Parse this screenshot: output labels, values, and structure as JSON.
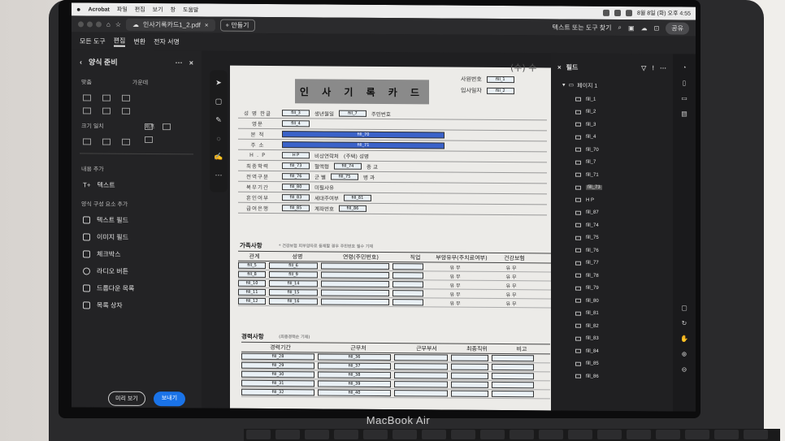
{
  "menubar": {
    "app": "Acrobat",
    "items": [
      "파일",
      "편집",
      "보기",
      "창",
      "도움말"
    ],
    "clock": "8월 8일 (화) 오후 4:55"
  },
  "tabbar": {
    "file_tab": "인사기록카드1_2.pdf",
    "new_tab": "+ 만들기",
    "search_tools": "텍스트 또는 도구 찾기",
    "share": "공유"
  },
  "toolrow": {
    "tabs": [
      "모든 도구",
      "편집",
      "변환",
      "전자 서명"
    ]
  },
  "left_panel": {
    "title": "양식 준비",
    "align_label": "맞춤",
    "horizontal_label": "가운데",
    "size_label": "크기 일치",
    "distribute_label": "배포",
    "add_content_label": "내용 추가",
    "text_item": "텍스트",
    "form_elements_label": "양식 구성 요소 추가",
    "form_items": [
      "텍스트 필드",
      "이미지 필드",
      "체크박스",
      "라디오 버튼",
      "드롭다운 목록",
      "목록 상자"
    ],
    "preview_button": "미리 보기",
    "next_button": "보내기"
  },
  "document": {
    "corner": "(수) 수",
    "title": "인 사 기 록 카 드",
    "top_fields": [
      {
        "label": "사원번호",
        "value": "fill_1"
      },
      {
        "label": "입사일자",
        "value": "fill_2"
      }
    ],
    "rows": [
      {
        "label": "성 명   한글",
        "field": "fill_3",
        "mid": "생년월일",
        "field2": "fill_7",
        "right": "주민번호"
      },
      {
        "label": "영문",
        "field": "fill_4",
        "mid": "",
        "field2": "",
        "right": ""
      },
      {
        "label": "본 적",
        "field": "fill_70",
        "mid": "",
        "field2": "",
        "right": ""
      },
      {
        "label": "주 소",
        "field": "fill_71",
        "mid": "",
        "field2": "",
        "right": ""
      },
      {
        "label": "H . P",
        "field": "H P",
        "mid": "비상연락처",
        "field2": "",
        "right": "(주택) 성명"
      },
      {
        "label": "최종학력",
        "field": "fill_73",
        "mid": "혈액형",
        "field2": "fill_74",
        "right": "종 교"
      },
      {
        "label": "전역구분",
        "field": "fill_76",
        "mid": "군 별",
        "field2": "fill_75",
        "right": "병 과"
      },
      {
        "label": "복무기간",
        "field": "fill_80",
        "mid": "미필사유",
        "field2": "",
        "right": ""
      },
      {
        "label": "혼인여부",
        "field": "fill_83",
        "mid": "세대주여부",
        "field2": "fill_81",
        "right": ""
      },
      {
        "label": "급여은행",
        "field": "fill_85",
        "mid": "계좌번호",
        "field2": "fill_86",
        "right": ""
      }
    ],
    "family": {
      "title": "가족사항",
      "note": "* 건강보험 피부양자로 등재할 경우 주민번호 필수 기재",
      "headers": [
        "관계",
        "성명",
        "연령(주민번호)",
        "직업",
        "부양유무(주치료여부)",
        "건강보험"
      ],
      "rows": [
        [
          "fill_5",
          "fill_6",
          "",
          "",
          "유 무",
          "유 무"
        ],
        [
          "fill_8",
          "fill_9",
          "",
          "",
          "유 무",
          "유 무"
        ],
        [
          "fill_10",
          "fill_14",
          "",
          "",
          "유 무",
          "유 무"
        ],
        [
          "fill_11",
          "fill_15",
          "",
          "",
          "유 무",
          "유 무"
        ],
        [
          "fill_12",
          "fill_16",
          "",
          "",
          "유 무",
          "유 무"
        ]
      ]
    },
    "career": {
      "title": "경력사항",
      "note": "(최종경력순 기재)",
      "headers": [
        "경력기간",
        "근무처",
        "근무부서",
        "최종직위",
        "비고"
      ],
      "rows": [
        [
          "fill_28",
          "fill_36",
          "",
          "",
          ""
        ],
        [
          "fill_29",
          "fill_37",
          "",
          "",
          ""
        ],
        [
          "fill_30",
          "fill_38",
          "",
          "",
          ""
        ],
        [
          "fill_31",
          "fill_39",
          "",
          "",
          ""
        ],
        [
          "fill_32",
          "fill_40",
          "",
          "",
          ""
        ]
      ]
    }
  },
  "right_panel": {
    "title": "필드",
    "page_label": "페이지 1",
    "fields": [
      "fill_1",
      "fill_2",
      "fill_3",
      "fill_4",
      "fill_70",
      "fill_7",
      "fill_71",
      "fill_73",
      "H P",
      "fill_87",
      "fill_74",
      "fill_75",
      "fill_76",
      "fill_77",
      "fill_78",
      "fill_79",
      "fill_80",
      "fill_81",
      "fill_82",
      "fill_83",
      "fill_84",
      "fill_85",
      "fill_86"
    ],
    "selected_index": 7
  },
  "laptop": {
    "brand": "MacBook Air"
  }
}
